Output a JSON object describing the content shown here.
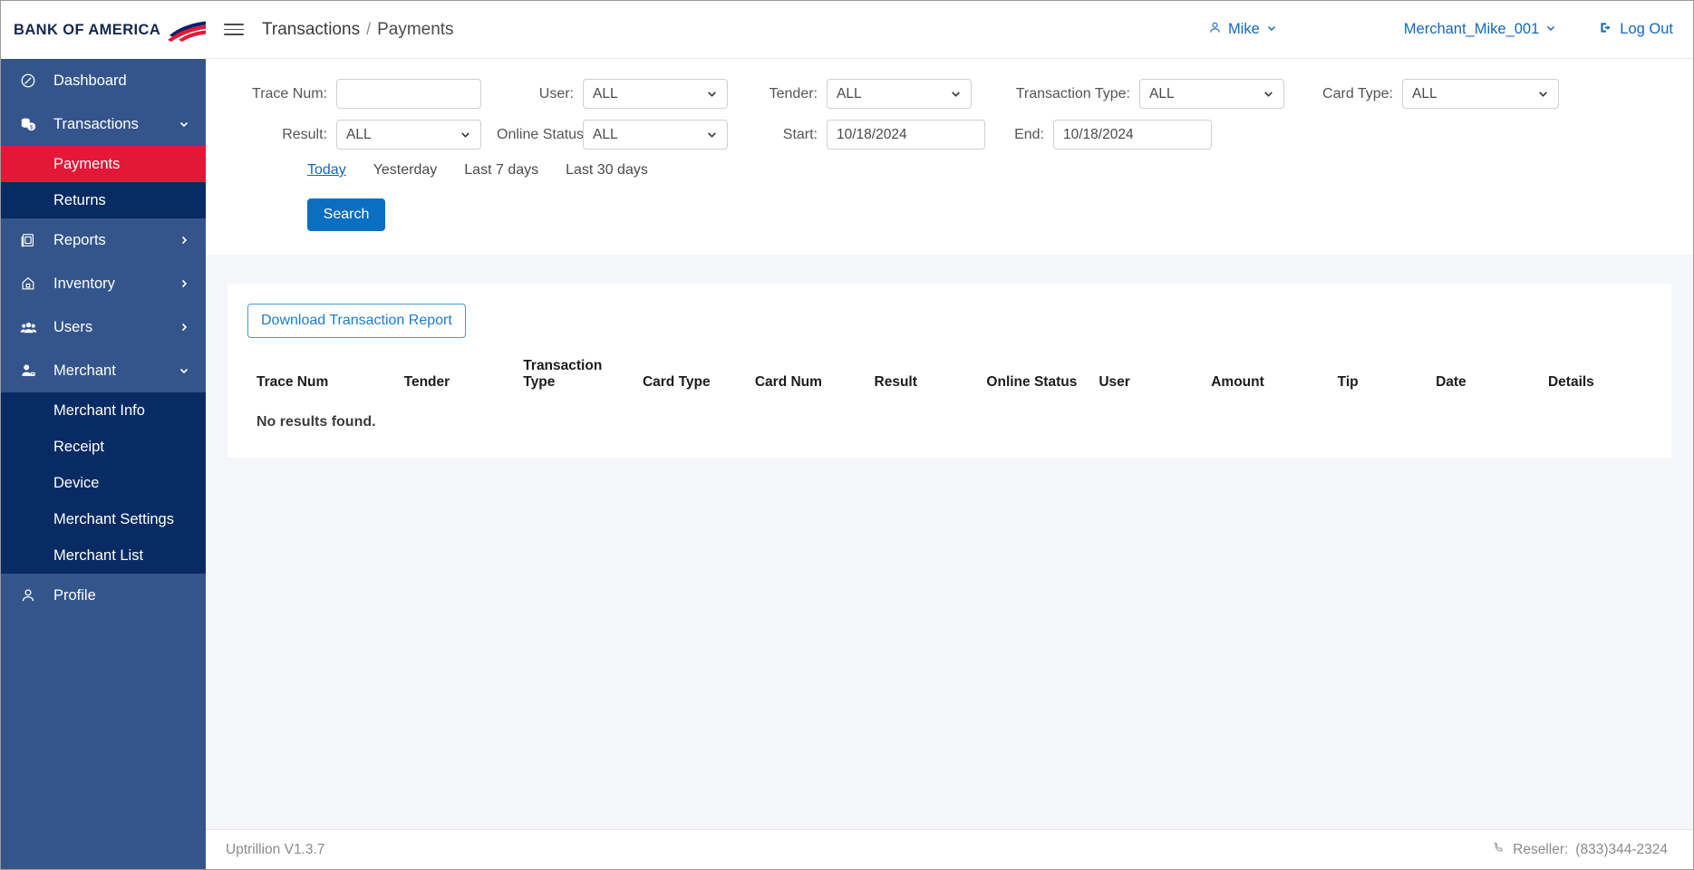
{
  "brand": {
    "name": "BANK OF AMERICA",
    "logo_icon": "bofa-flag-icon"
  },
  "sidebar": {
    "items": [
      {
        "label": "Dashboard",
        "icon": "dashboard-gauge-icon",
        "has_chevron": false,
        "expanded": false
      },
      {
        "label": "Transactions",
        "icon": "money-coins-icon",
        "has_chevron": true,
        "expanded": true,
        "children": [
          {
            "label": "Payments",
            "selected": true
          },
          {
            "label": "Returns",
            "selected": false
          }
        ]
      },
      {
        "label": "Reports",
        "icon": "report-document-icon",
        "has_chevron": true,
        "expanded": false
      },
      {
        "label": "Inventory",
        "icon": "home-box-icon",
        "has_chevron": true,
        "expanded": false
      },
      {
        "label": "Users",
        "icon": "users-group-icon",
        "has_chevron": true,
        "expanded": false
      },
      {
        "label": "Merchant",
        "icon": "user-badge-icon",
        "has_chevron": true,
        "expanded": true,
        "children": [
          {
            "label": "Merchant Info",
            "selected": false
          },
          {
            "label": "Receipt",
            "selected": false
          },
          {
            "label": "Device",
            "selected": false
          },
          {
            "label": "Merchant Settings",
            "selected": false
          },
          {
            "label": "Merchant List",
            "selected": false
          }
        ]
      },
      {
        "label": "Profile",
        "icon": "profile-person-icon",
        "has_chevron": false,
        "expanded": false
      }
    ],
    "colors": {
      "background": "#34558b",
      "submenu_background": "#092b63",
      "selected": "#e31837"
    }
  },
  "topbar": {
    "menu_icon": "hamburger-icon",
    "breadcrumb": {
      "parent": "Transactions",
      "separator": "/",
      "current": "Payments"
    },
    "user": {
      "label": "Mike",
      "icon": "person-icon",
      "caret": "chevron-down-icon"
    },
    "merchant": {
      "label": "Merchant_Mike_001",
      "caret": "chevron-down-icon"
    },
    "logout": {
      "label": "Log Out",
      "icon": "logout-icon"
    },
    "link_color": "#1466bb"
  },
  "filters": {
    "row1": [
      {
        "label": "Trace Num:",
        "type": "input",
        "value": "",
        "placeholder": ""
      },
      {
        "label": "User:",
        "type": "select",
        "value": "ALL"
      },
      {
        "label": "Tender:",
        "type": "select",
        "value": "ALL"
      },
      {
        "label": "Transaction Type:",
        "type": "select",
        "value": "ALL"
      },
      {
        "label": "Card Type:",
        "type": "select",
        "value": "ALL"
      }
    ],
    "row2": [
      {
        "label": "Result:",
        "type": "select",
        "value": "ALL"
      },
      {
        "label": "Online Status:",
        "type": "select",
        "value": "ALL"
      },
      {
        "label": "Start:",
        "type": "date",
        "value": "10/18/2024"
      },
      {
        "label": "End:",
        "type": "date",
        "value": "10/18/2024"
      }
    ],
    "quick_ranges": [
      {
        "label": "Today",
        "active": true
      },
      {
        "label": "Yesterday",
        "active": false
      },
      {
        "label": "Last 7 days",
        "active": false
      },
      {
        "label": "Last 30 days",
        "active": false
      }
    ],
    "search_button": "Search"
  },
  "results": {
    "download_button": "Download Transaction Report",
    "columns": [
      "Trace Num",
      "Tender",
      "Transaction Type",
      "Card Type",
      "Card Num",
      "Result",
      "Online Status",
      "User",
      "Amount",
      "Tip",
      "Date",
      "Details"
    ],
    "empty_message": "No results found.",
    "rows": []
  },
  "footer": {
    "version": "Uptrillion V1.3.7",
    "reseller_label": "Reseller:",
    "reseller_phone": "(833)344-2324",
    "phone_icon": "phone-icon"
  }
}
